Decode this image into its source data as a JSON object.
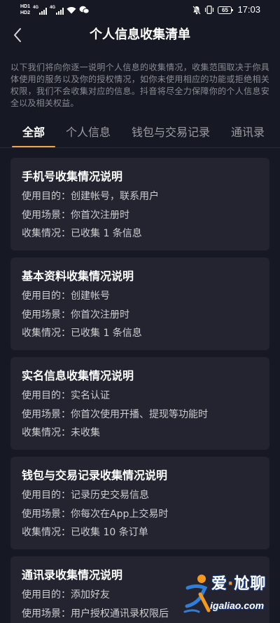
{
  "status_bar": {
    "hd1": "HD1",
    "hd2": "HD2",
    "sim1_network": "4G",
    "sim2_network": "4G",
    "battery": "65",
    "time": "17:03",
    "icons": [
      "signal-icon",
      "wifi-icon",
      "wechat-icon",
      "bell-off-icon",
      "vibrate-icon",
      "battery-icon"
    ]
  },
  "header": {
    "back_icon": "chevron-left-icon",
    "title": "个人信息收集清单"
  },
  "intro": "以下我们将向你逐一说明个人信息的收集情况，收集范围取决于你具体使用的服务以及你的授权情况，如你未使用相应的功能或拒绝相关权限，我们不会收集对应的信息。抖音将尽全力保障你的个人信息安全以及相关权益。",
  "tabs": [
    {
      "label": "全部",
      "selected": true
    },
    {
      "label": "个人信息",
      "selected": false
    },
    {
      "label": "钱包与交易记录",
      "selected": false
    },
    {
      "label": "通讯录",
      "selected": false
    }
  ],
  "cards": [
    {
      "title": "手机号收集情况说明",
      "lines": [
        {
          "label": "使用目的：",
          "value": "创建帐号，联系用户"
        },
        {
          "label": "使用场景：",
          "value": "你首次注册时"
        },
        {
          "label": "收集情况：",
          "value": "已收集 1 条信息"
        }
      ]
    },
    {
      "title": "基本资料收集情况说明",
      "lines": [
        {
          "label": "使用目的：",
          "value": "创建帐号"
        },
        {
          "label": "使用场景：",
          "value": "你首次注册时"
        },
        {
          "label": "收集情况：",
          "value": "已收集 1 条信息"
        }
      ]
    },
    {
      "title": "实名信息收集情况说明",
      "lines": [
        {
          "label": "使用目的：",
          "value": "实名认证"
        },
        {
          "label": "使用场景：",
          "value": "你首次使用开播、提现等功能时"
        },
        {
          "label": "收集情况：",
          "value": "未收集"
        }
      ]
    },
    {
      "title": "钱包与交易记录收集情况说明",
      "lines": [
        {
          "label": "使用目的：",
          "value": "记录历史交易信息"
        },
        {
          "label": "使用场景：",
          "value": "你每次在App上交易时"
        },
        {
          "label": "收集情况：",
          "value": "已收集 10 条订单"
        }
      ]
    },
    {
      "title": "通讯录收集情况说明",
      "lines": [
        {
          "label": "使用目的：",
          "value": "添加好友"
        },
        {
          "label": "使用场景：",
          "value": "用户授权通讯录权限后"
        }
      ]
    }
  ],
  "watermark": {
    "brand_part1": "爱",
    "brand_dot": "·",
    "brand_part2": "尬聊",
    "domain": "igaliao.com",
    "logo_icon": "igaliao-logo-icon"
  },
  "colors": {
    "background": "#161823",
    "card": "#232430",
    "accent": "#f2a548",
    "text_primary": "#ffffff",
    "text_secondary": "#8a8b93",
    "text_body": "#cdced2",
    "text_tab": "#9c9da3",
    "divider": "#2a2b36",
    "wm_orange": "#f39a1e",
    "wm_blue": "#2f7fd8"
  }
}
